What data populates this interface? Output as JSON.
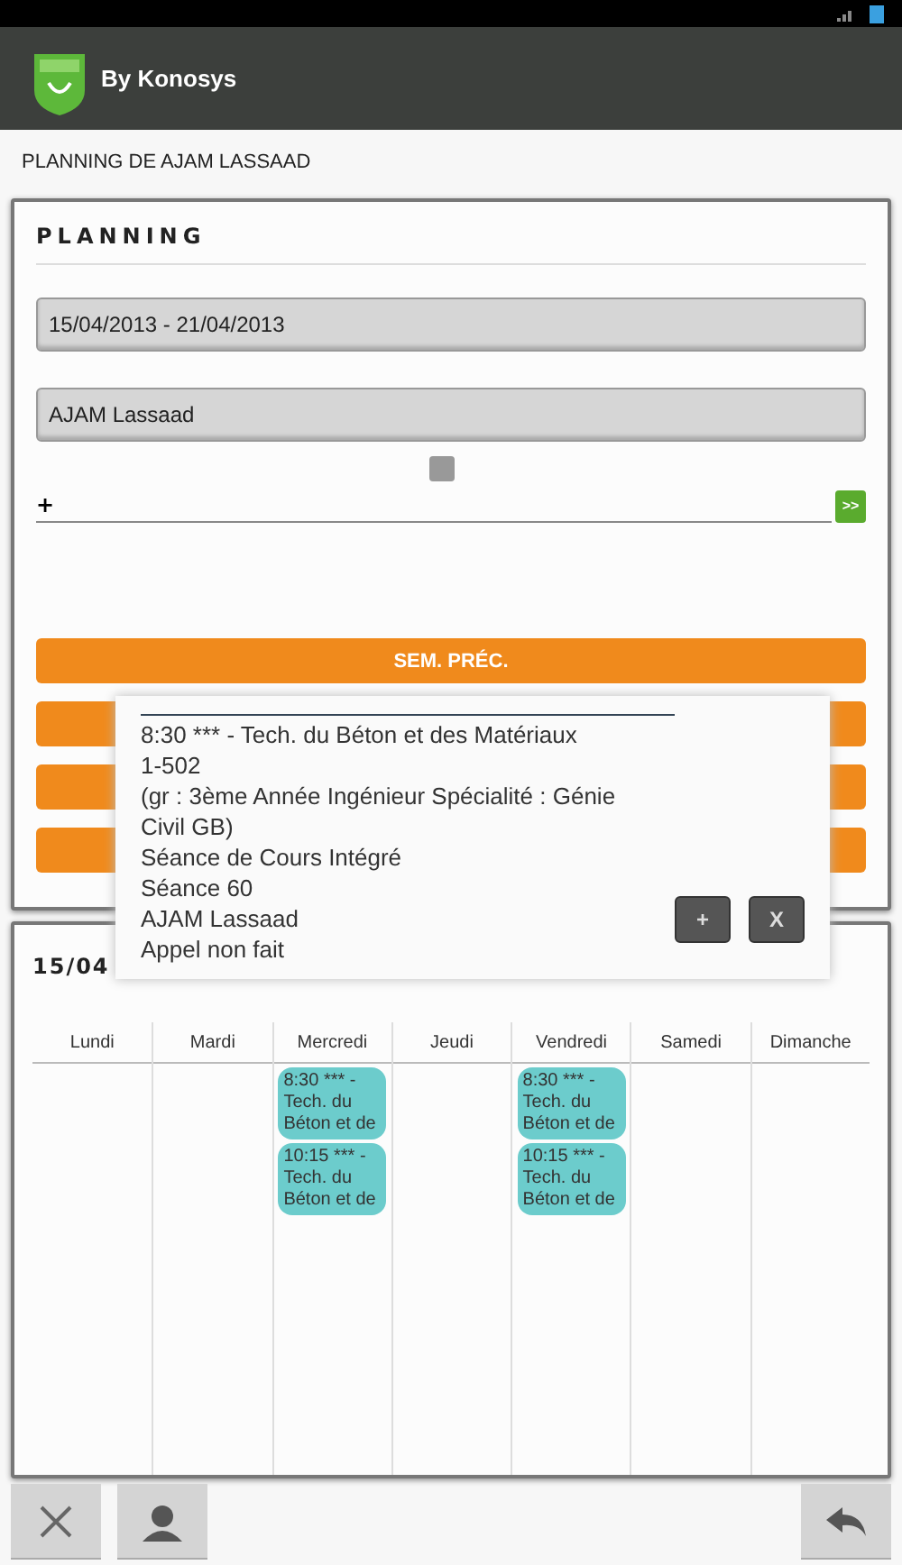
{
  "app_bar": {
    "brand": "By Konosys"
  },
  "page_title": "PLANNING DE AJAM LASSAAD",
  "planning": {
    "title": "PLANNING",
    "date_field": {
      "value": "15/04/2013 - 21/04/2013"
    },
    "teacher_field": {
      "value": "AJAM Lassaad"
    },
    "checkbox": {
      "checked": false
    },
    "add_field": {
      "label": "+"
    },
    "go_button": {
      "label": ">>"
    },
    "prev_button": {
      "label": "SEM. PRÉC."
    }
  },
  "popup": {
    "lines": [
      "8:30 *** - Tech. du Béton et des Matériaux",
      "1-502",
      "(gr : 3ème Année Ingénieur Spécialité : Génie Civil GB)",
      "Séance de Cours Intégré",
      "Séance 60",
      "AJAM Lassaad",
      "Appel non fait"
    ],
    "buttons": [
      "+",
      "X"
    ]
  },
  "calendar": {
    "title": "15/04",
    "days": [
      {
        "name": "Lundi"
      },
      {
        "name": "Mardi"
      },
      {
        "name": "Mercredi",
        "events": [
          "8:30 *** - Tech. du Béton et de",
          "10:15 *** - Tech. du Béton et de"
        ]
      },
      {
        "name": "Jeudi"
      },
      {
        "name": "Vendredi",
        "events": [
          "8:30 *** - Tech. du Béton et de",
          "10:15 *** - Tech. du Béton et de"
        ]
      },
      {
        "name": "Samedi"
      },
      {
        "name": "Dimanche"
      }
    ]
  }
}
